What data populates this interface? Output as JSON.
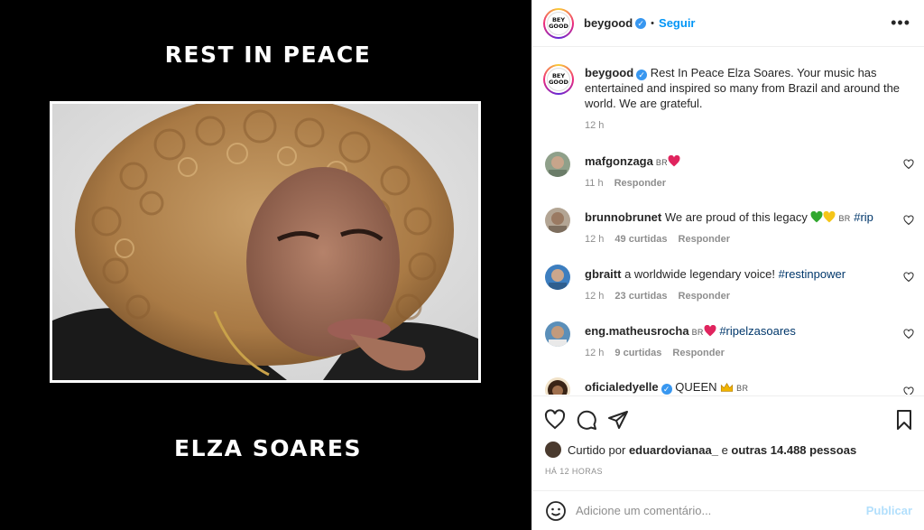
{
  "media": {
    "top_text": "REST IN PEACE",
    "bottom_text": "ELZA SOARES"
  },
  "header": {
    "username": "beygood",
    "avatar_text": "BEY GOOD",
    "follow_label": "Seguir",
    "more_icon": "more-horizontal-icon"
  },
  "caption": {
    "username": "beygood",
    "text": "Rest In Peace Elza Soares. Your music has entertained and inspired so many from Brazil and around the world. We are grateful.",
    "time": "12 h"
  },
  "comments": [
    {
      "username": "mafgonzaga",
      "text": "",
      "badge": "BR",
      "time": "11 h",
      "likes": "",
      "reply": "Responder"
    },
    {
      "username": "brunnobrunet",
      "text": "We are proud of this legacy",
      "badge": "BR",
      "hashtag": "#rip",
      "time": "12 h",
      "likes": "49 curtidas",
      "reply": "Responder"
    },
    {
      "username": "gbraitt",
      "text": "a worldwide legendary voice!",
      "hashtag": "#restinpower",
      "time": "12 h",
      "likes": "23 curtidas",
      "reply": "Responder"
    },
    {
      "username": "eng.matheusrocha",
      "badge": "BR",
      "hashtag": "#ripelzasoares",
      "time": "12 h",
      "likes": "9 curtidas",
      "reply": "Responder"
    },
    {
      "username": "oficialedyelle",
      "text": "QUEEN",
      "badge": "BR"
    }
  ],
  "actions": {
    "liked_prefix": "Curtido por",
    "liked_user": "eduardovianaa_",
    "liked_mid": "e",
    "liked_others": "outras 14.488 pessoas",
    "timestamp": "HÁ 12 HORAS"
  },
  "composer": {
    "placeholder": "Adicione um comentário...",
    "publish_label": "Publicar"
  },
  "colors": {
    "accent": "#0095f6",
    "verified": "#3897f0",
    "link": "#00376b",
    "muted": "#8e8e8e"
  }
}
